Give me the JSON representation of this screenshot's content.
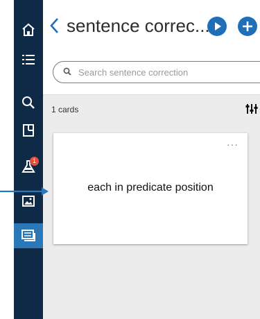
{
  "header": {
    "title": "sentence correc..."
  },
  "search": {
    "placeholder": "Search sentence correction"
  },
  "list": {
    "count_label": "1 cards"
  },
  "cards": [
    {
      "front_text": "each in predicate position",
      "menu": "···"
    }
  ],
  "sidebar": {
    "items": [
      {
        "icon": "home-icon"
      },
      {
        "icon": "list-icon"
      },
      {
        "icon": "search-icon"
      },
      {
        "icon": "deck-icon"
      },
      {
        "icon": "lab-flask-icon",
        "badge": "1"
      },
      {
        "icon": "image-icon"
      },
      {
        "icon": "cards-icon",
        "active": true
      }
    ]
  },
  "colors": {
    "sidebar_bg": "#0e2a47",
    "sidebar_active": "#2b78b9",
    "accent": "#1f6fb8",
    "badge": "#e74c3c"
  }
}
